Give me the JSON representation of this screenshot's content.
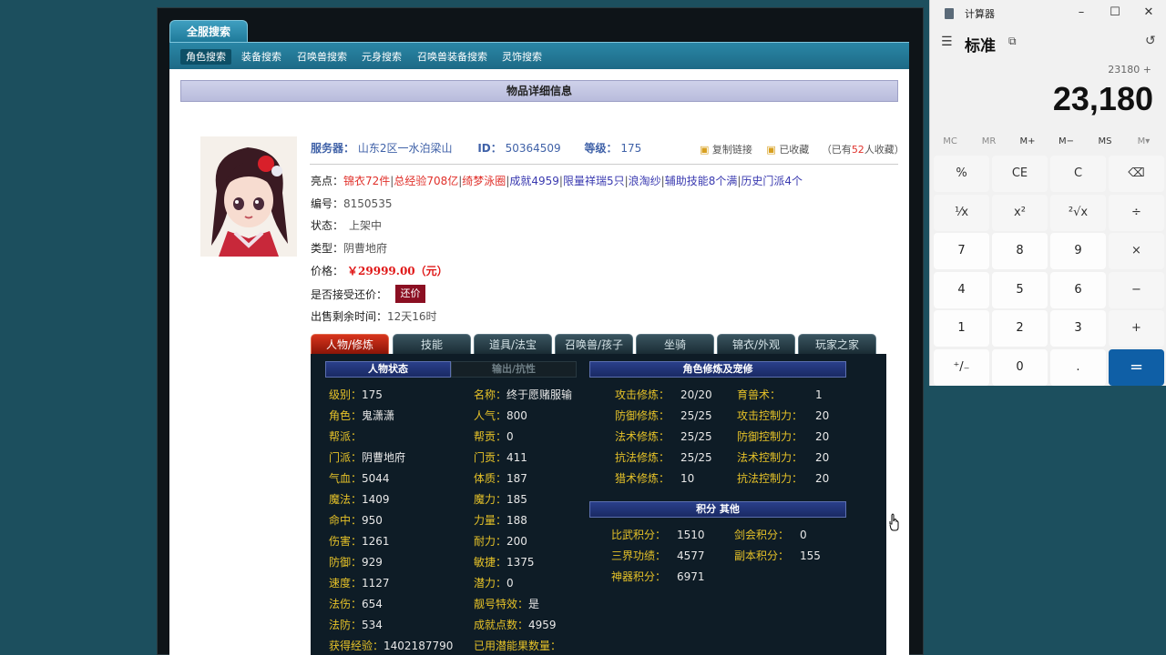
{
  "search_tab": "全服搜索",
  "nav": [
    "角色搜索",
    "装备搜索",
    "召唤兽搜索",
    "元身搜索",
    "召唤兽装备搜索",
    "灵饰搜索"
  ],
  "panel_title": "物品详细信息",
  "server": {
    "label": "服务器：",
    "value": "山东2区一水泊梁山",
    "id_label": "ID：",
    "id_value": "50364509",
    "level_label": "等级：",
    "level_value": "175"
  },
  "actions": {
    "copy_link": "复制链接",
    "favorited": "已收藏",
    "fav_count_prefix": "（已有",
    "fav_count": "52",
    "fav_count_suffix": "人收藏）"
  },
  "highlights": {
    "label": "亮点：",
    "items": [
      "锦衣72件",
      "总经验708亿",
      "绮梦泳圈",
      "成就4959",
      "限量祥瑞5只",
      "浪淘纱",
      "辅助技能8个满",
      "历史门派4个"
    ]
  },
  "serial": {
    "label": "编号：",
    "value": "8150535"
  },
  "status": {
    "label": "状态：",
    "value": "上架中"
  },
  "type": {
    "label": "类型：",
    "value": "阴曹地府"
  },
  "price": {
    "label": "价格：",
    "value": "￥29999.00（元）"
  },
  "counter_offer": {
    "label": "是否接受还价：",
    "button": "还价"
  },
  "remaining": {
    "label": "出售剩余时间：",
    "value": "12天16时"
  },
  "tabs": [
    "人物/修炼",
    "技能",
    "道具/法宝",
    "召唤兽/孩子",
    "坐骑",
    "锦衣/外观",
    "玩家之家"
  ],
  "sections": {
    "char_status": "人物状态",
    "output": "输出/抗性",
    "cultivation": "角色修炼及宠修",
    "score": "积分 其他"
  },
  "col1": [
    {
      "k": "级别：",
      "v": "175"
    },
    {
      "k": "角色：",
      "v": "鬼潇潇"
    },
    {
      "k": "帮派：",
      "v": ""
    },
    {
      "k": "门派：",
      "v": "阴曹地府"
    },
    {
      "k": "气血：",
      "v": "5044"
    },
    {
      "k": "魔法：",
      "v": "1409"
    },
    {
      "k": "命中：",
      "v": "950"
    },
    {
      "k": "伤害：",
      "v": "1261"
    },
    {
      "k": "防御：",
      "v": "929"
    },
    {
      "k": "速度：",
      "v": "1127"
    },
    {
      "k": "法伤：",
      "v": "654"
    },
    {
      "k": "法防：",
      "v": "534"
    },
    {
      "k": "获得经验：",
      "v": "1402187790"
    }
  ],
  "col2": [
    {
      "k": "名称：",
      "v": "终于愿赌服输"
    },
    {
      "k": "人气：",
      "v": "800"
    },
    {
      "k": "帮贡：",
      "v": "0"
    },
    {
      "k": "门贡：",
      "v": "411"
    },
    {
      "k": "体质：",
      "v": "187"
    },
    {
      "k": "魔力：",
      "v": "185"
    },
    {
      "k": "力量：",
      "v": "188"
    },
    {
      "k": "耐力：",
      "v": "200"
    },
    {
      "k": "敏捷：",
      "v": "1375"
    },
    {
      "k": "潜力：",
      "v": "0"
    },
    {
      "k": "靓号特效：",
      "v": "是"
    },
    {
      "k": "成就点数：",
      "v": "4959"
    },
    {
      "k": "已用潜能果数量：",
      "v": ""
    }
  ],
  "cult_left": [
    {
      "k": "攻击修炼：",
      "v": "20/20"
    },
    {
      "k": "防御修炼：",
      "v": "25/25"
    },
    {
      "k": "法术修炼：",
      "v": "25/25"
    },
    {
      "k": "抗法修炼：",
      "v": "25/25"
    },
    {
      "k": "猎术修炼：",
      "v": "10"
    }
  ],
  "cult_right": [
    {
      "k": "育兽术：",
      "v": "1"
    },
    {
      "k": "攻击控制力：",
      "v": "20"
    },
    {
      "k": "防御控制力：",
      "v": "20"
    },
    {
      "k": "法术控制力：",
      "v": "20"
    },
    {
      "k": "抗法控制力：",
      "v": "20"
    }
  ],
  "score_left": [
    {
      "k": "比武积分：",
      "v": "1510"
    },
    {
      "k": "三界功绩：",
      "v": "4577"
    },
    {
      "k": "神器积分：",
      "v": "6971"
    }
  ],
  "score_right": [
    {
      "k": "剑会积分：",
      "v": "0"
    },
    {
      "k": "副本积分：",
      "v": "155"
    }
  ],
  "calculator": {
    "app_name": "计算器",
    "mode": "标准",
    "expression": "23180 +",
    "display": "23,180",
    "memory": [
      "MC",
      "MR",
      "M+",
      "M−",
      "MS",
      "M▾"
    ],
    "keys": [
      "%",
      "CE",
      "C",
      "⌫",
      "⅟x",
      "x²",
      "²√x",
      "÷",
      "7",
      "8",
      "9",
      "×",
      "4",
      "5",
      "6",
      "−",
      "1",
      "2",
      "3",
      "+",
      "⁺/₋",
      "0",
      ".",
      "="
    ]
  },
  "colors": {
    "accent": "#0f5fa6",
    "price_red": "#e01818",
    "label_yellow": "#e6c228",
    "tab_active": "#d8341d"
  }
}
